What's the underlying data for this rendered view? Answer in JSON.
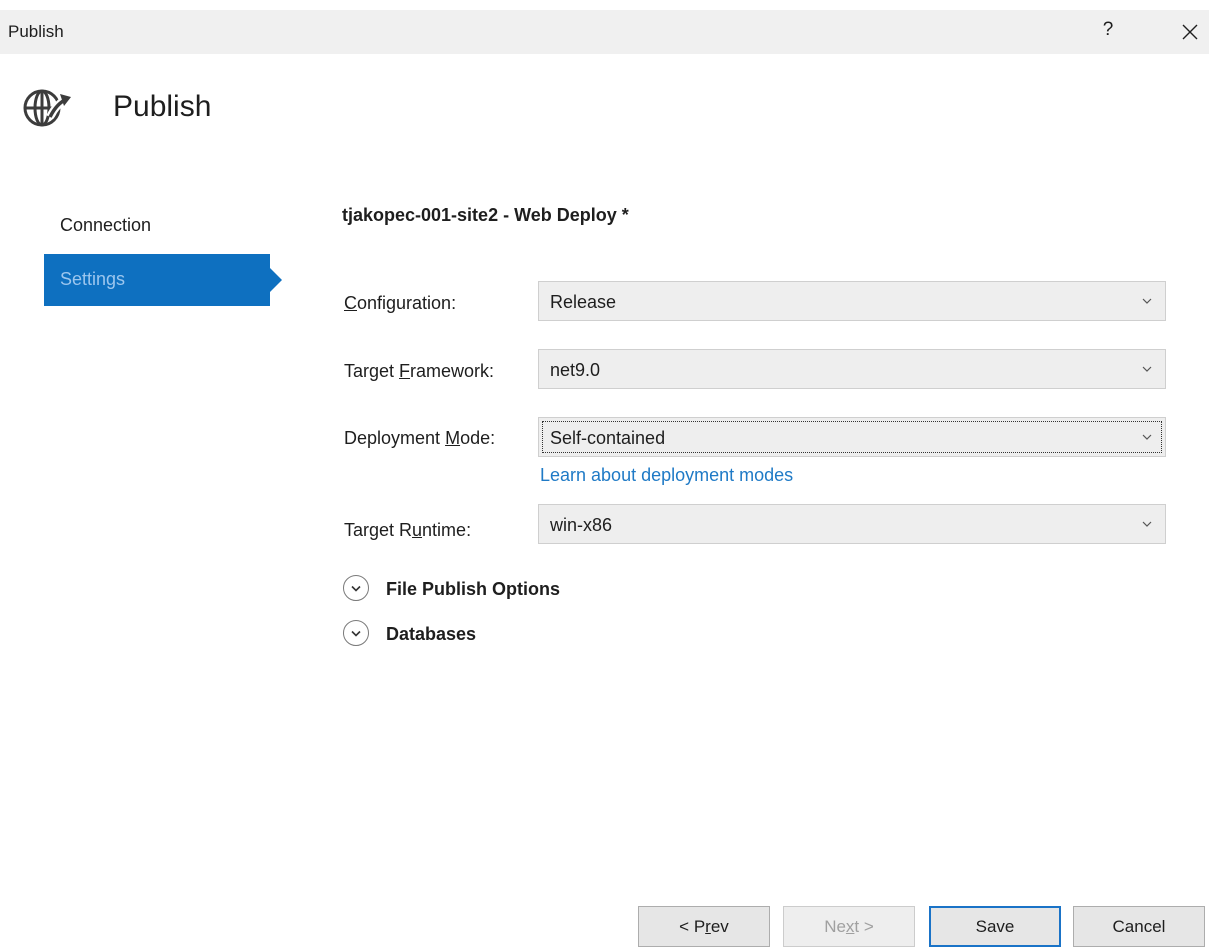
{
  "window": {
    "title": "Publish",
    "help_label": "?"
  },
  "header": {
    "title": "Publish",
    "icon": "globe-publish-icon"
  },
  "nav": [
    {
      "label": "Connection",
      "selected": false
    },
    {
      "label": "Settings",
      "selected": true
    }
  ],
  "profile": {
    "title": "tjakopec-001-site2 - Web Deploy *"
  },
  "fields": {
    "configuration": {
      "label_pre": "",
      "label_access": "C",
      "label_post": "onfiguration:",
      "value": "Release"
    },
    "target_framework": {
      "label_pre": "Target ",
      "label_access": "F",
      "label_post": "ramework:",
      "value": "net9.0"
    },
    "deployment_mode": {
      "label_pre": "Deployment ",
      "label_access": "M",
      "label_post": "ode:",
      "value": "Self-contained"
    },
    "target_runtime": {
      "label_pre": "Target R",
      "label_access": "u",
      "label_post": "ntime:",
      "value": "win-x86"
    }
  },
  "learn_link": "Learn about deployment modes",
  "expanders": {
    "file_publish": "File Publish Options",
    "databases": "Databases"
  },
  "buttons": {
    "prev": {
      "pre": "< P",
      "access": "r",
      "post": "ev"
    },
    "next": {
      "pre": "Ne",
      "access": "x",
      "post": "t >"
    },
    "save": "Save",
    "cancel": "Cancel"
  },
  "colors": {
    "accent": "#0e70c0",
    "link": "#1f7ac6"
  }
}
